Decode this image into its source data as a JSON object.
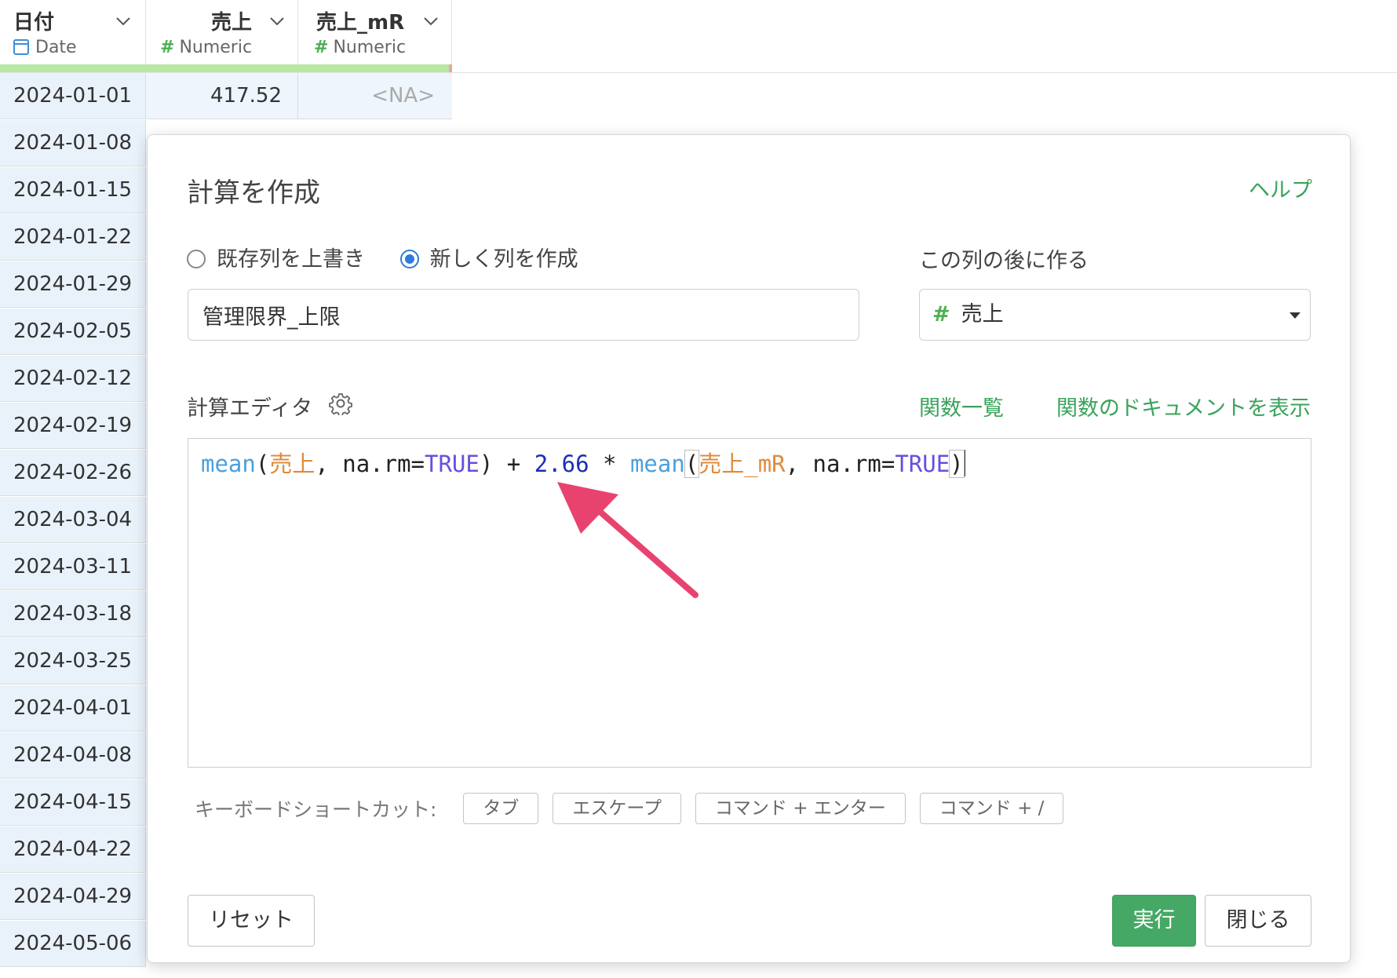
{
  "grid": {
    "columns": [
      {
        "name": "日付",
        "type": "Date"
      },
      {
        "name": "売上",
        "type": "Numeric"
      },
      {
        "name": "売上_mR",
        "type": "Numeric"
      }
    ],
    "first_row": {
      "date": "2024-01-01",
      "value": "417.52",
      "mr": "<NA>"
    },
    "dates": [
      "2024-01-08",
      "2024-01-15",
      "2024-01-22",
      "2024-01-29",
      "2024-02-05",
      "2024-02-12",
      "2024-02-19",
      "2024-02-26",
      "2024-03-04",
      "2024-03-11",
      "2024-03-18",
      "2024-03-25",
      "2024-04-01",
      "2024-04-08",
      "2024-04-15",
      "2024-04-22",
      "2024-04-29",
      "2024-05-06"
    ]
  },
  "dialog": {
    "title": "計算を作成",
    "help": "ヘルプ",
    "radio_overwrite": "既存列を上書き",
    "radio_new": "新しく列を作成",
    "after_label": "この列の後に作る",
    "column_name_value": "管理限界_上限",
    "after_column": "売上",
    "editor_label": "計算エディタ",
    "func_list": "関数一覧",
    "func_doc": "関数のドキュメントを表示",
    "code": {
      "fn1": "mean",
      "p1": "(",
      "col1": "売上",
      "a1": ", na.rm=",
      "const1": "TRUE",
      "c1": ") + ",
      "num": "2.66",
      "star": " * ",
      "fn2": "mean",
      "p2": "(",
      "col2": "売上_mR",
      "a2": ", na.rm=",
      "const2": "TRUE",
      "c2": ")"
    },
    "shortcuts_label": "キーボードショートカット:",
    "shortcuts": [
      "タブ",
      "エスケープ",
      "コマンド + エンター",
      "コマンド + /"
    ],
    "reset": "リセット",
    "run": "実行",
    "close": "閉じる"
  },
  "colors": {
    "accent": "#46a865",
    "link": "#3aa35b",
    "arrow": "#e8436f",
    "radio": "#2f7bd9"
  }
}
